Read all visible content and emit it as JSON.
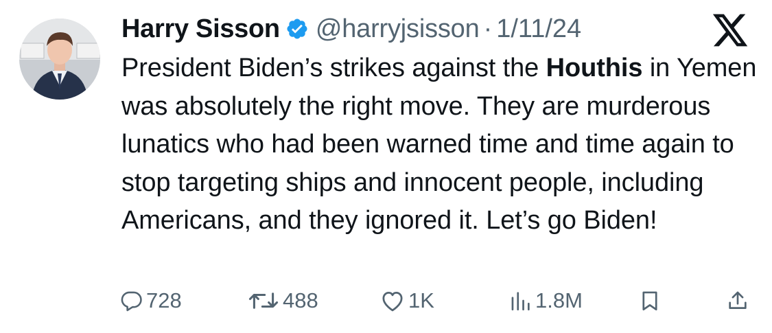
{
  "tweet": {
    "author": {
      "display_name": "Harry Sisson",
      "handle": "@harryjsisson",
      "verified": true,
      "avatar_icon": "avatar-photo"
    },
    "separator": "·",
    "date": "1/11/24",
    "platform_icon": "x-logo-icon",
    "text": {
      "part1": "President Biden’s strikes against the ",
      "bold": "Houthis",
      "part2": " in Yemen was absolutely the right move. They are murderous lunatics who had been warned time and time again to stop targeting ships and innocent people, including Americans, and they ignored it. Let’s go Biden!"
    },
    "stats": {
      "replies": "728",
      "reposts": "488",
      "likes": "1K",
      "views": "1.8M"
    },
    "icons": {
      "reply": "reply-icon",
      "repost": "repost-icon",
      "like": "like-icon",
      "views": "views-icon",
      "bookmark": "bookmark-icon",
      "share": "share-icon"
    },
    "colors": {
      "text": "#0f1419",
      "secondary": "#536471",
      "verified_blue": "#1d9bf0",
      "background": "#ffffff"
    }
  }
}
